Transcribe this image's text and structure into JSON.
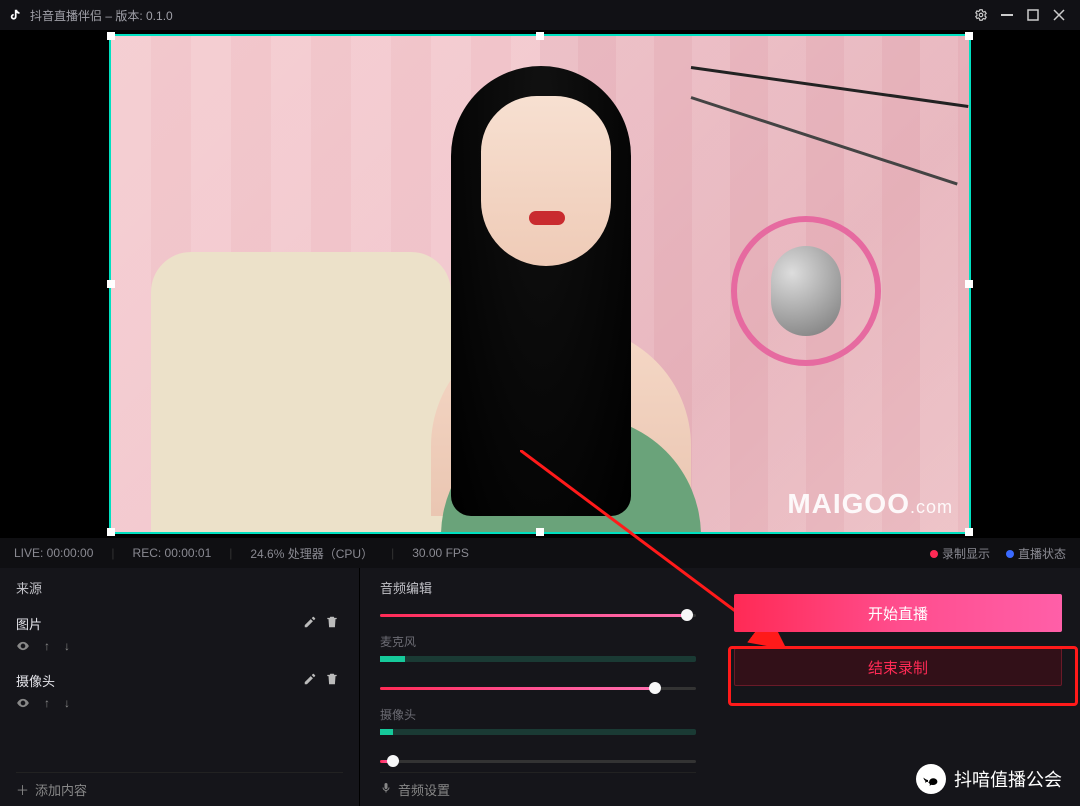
{
  "titlebar": {
    "title": "抖音直播伴侣 – 版本: 0.1.0"
  },
  "status": {
    "live": "LIVE: 00:00:00",
    "rec": "REC: 00:00:01",
    "cpu": "24.6% 处理器（CPU）",
    "fps": "30.00 FPS",
    "record_indicator": "录制显示",
    "stream_indicator": "直播状态"
  },
  "sources": {
    "title": "来源",
    "items": [
      {
        "name": "图片"
      },
      {
        "name": "摄像头"
      }
    ],
    "add_label": "添加内容"
  },
  "audio": {
    "title": "音频编辑",
    "mic_label": "麦克风",
    "cam_label": "摄像头",
    "settings_label": "音频设置",
    "slider1_fill_pct": 97,
    "mic_level_pct": 8,
    "slider2_fill_pct": 87,
    "cam_level_pct": 4
  },
  "actions": {
    "start_label": "开始直播",
    "stop_label": "结束录制"
  },
  "watermark": {
    "main": "MAIGOO",
    "suffix": ".com"
  },
  "wechat_tip": "抖喑值播公会"
}
